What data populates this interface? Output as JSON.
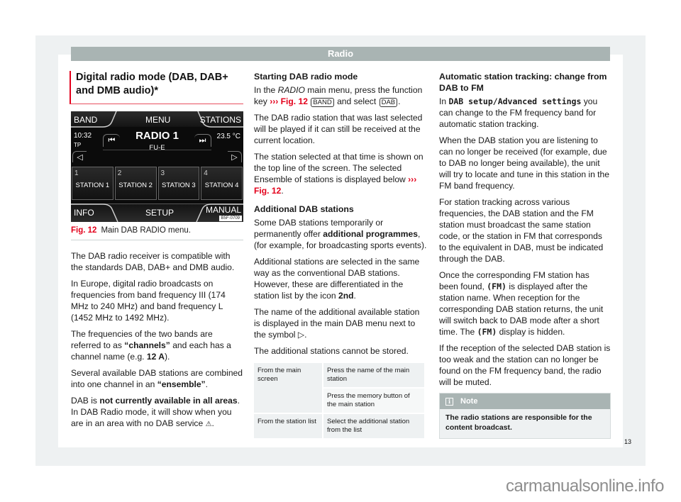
{
  "header": {
    "title": "Radio"
  },
  "col1": {
    "section_title": "Digital radio mode (DAB, DAB+ and DMB audio)*",
    "figure": {
      "screen": {
        "top_buttons": [
          "BAND",
          "MENU",
          "STATIONS"
        ],
        "time": "10:32",
        "tp": "TP",
        "temperature": "23.5 °C",
        "station_name": "RADIO 1",
        "ensemble": "FU-E",
        "seek_back_icon": "⏮",
        "seek_fwd_icon": "⏭",
        "nav_left_icon": "◁",
        "nav_right_icon": "▷",
        "presets": [
          {
            "num": "1",
            "name": "STATION 1"
          },
          {
            "num": "2",
            "name": "STATION 2"
          },
          {
            "num": "3",
            "name": "STATION 3"
          },
          {
            "num": "4",
            "name": "STATION 4"
          }
        ],
        "bottom_buttons": [
          "INFO",
          "SETUP",
          "MANUAL"
        ],
        "code": "B5F-0709"
      },
      "caption_label": "Fig. 12",
      "caption_text": "Main DAB RADIO menu."
    },
    "p1": "The DAB radio receiver is compatible with the standards DAB, DAB+ and DMB audio.",
    "p2": "In Europe, digital radio broadcasts on frequencies from band frequency III (174 MHz to 240 MHz) and band frequency L (1452 MHz to 1492 MHz).",
    "p3_a": "The frequencies of the two bands are referred to as ",
    "p3_b": "“channels”",
    "p3_c": " and each has a channel name (e.g. ",
    "p3_d": "12  A",
    "p3_e": ").",
    "p4_a": "Several available DAB stations are combined into one channel in an ",
    "p4_b": "“ensemble”",
    "p4_c": ".",
    "p5_a": "DAB is ",
    "p5_b": "not currently available in all areas",
    "p5_c": ". In DAB Radio mode, it will show when you are in an area with no DAB service ",
    "p5_icon": "⚠",
    "p5_d": "."
  },
  "col2": {
    "h1": "Starting DAB radio mode",
    "p1_a": "In the ",
    "p1_b": "RADIO",
    "p1_c": " main menu, press the function key ",
    "p1_ref": "››› Fig. 12",
    "p1_key1": "BAND",
    "p1_d": " and select ",
    "p1_key2": "DAB",
    "p1_e": ".",
    "p2": "The DAB radio station that was last selected will be played if it can still be received at the current location.",
    "p3_a": "The station selected at that time is shown on the top line of the screen. The selected Ensemble of stations is displayed below ",
    "p3_ref": "››› Fig. 12",
    "p3_b": ".",
    "h2": "Additional DAB stations",
    "p4_a": "Some DAB stations temporarily or permanently offer ",
    "p4_b": "additional programmes",
    "p4_c": ", (for example, for broadcasting sports events).",
    "p5_a": "Additional stations are selected in the same way as the conventional DAB stations. However, these are differentiated in the station list by the icon ",
    "p5_b": "2nd",
    "p5_c": ".",
    "p6": "The name of the additional available station is displayed in the main DAB menu next to the symbol ▷.",
    "p7": "The additional stations cannot be stored.",
    "table": [
      {
        "c1": "From the main screen",
        "c2": "Press the name of the main station"
      },
      {
        "c1": "",
        "c2": "Press the memory button of the main station"
      },
      {
        "c1": "From the station list",
        "c2": "Select the additional station from the list"
      }
    ]
  },
  "col3": {
    "h1": "Automatic station tracking: change from DAB to FM",
    "p1_a": "In ",
    "p1_b": "DAB setup/Advanced settings",
    "p1_c": " you can change to the FM frequency band for automatic station tracking.",
    "p2": "When the DAB station you are listening to can no longer be received (for example, due to DAB no longer being available), the unit will try to locate and tune in this station in the FM band frequency.",
    "p3": "For station tracking across various frequencies, the DAB station and the FM station must broadcast the same station code, or the station in FM that corresponds to the equivalent in DAB, must be indicated through the DAB.",
    "p4_a": "Once the corresponding FM station has been found, ",
    "p4_b": "(FM)",
    "p4_c": " is displayed after the station name. When reception for the corresponding DAB station returns, the unit will switch back to DAB mode after a short time. The ",
    "p4_d": "(FM)",
    "p4_e": " display is hidden.",
    "p5": "If the reception of the selected DAB station is too weak and the station can no longer be found on the FM frequency band, the radio will be muted.",
    "note": {
      "title": "Note",
      "icon": "i",
      "body": "The radio stations are responsible for the content broadcast."
    }
  },
  "footer": {
    "page_number": "13",
    "watermark": "carmanualsonline.info"
  }
}
